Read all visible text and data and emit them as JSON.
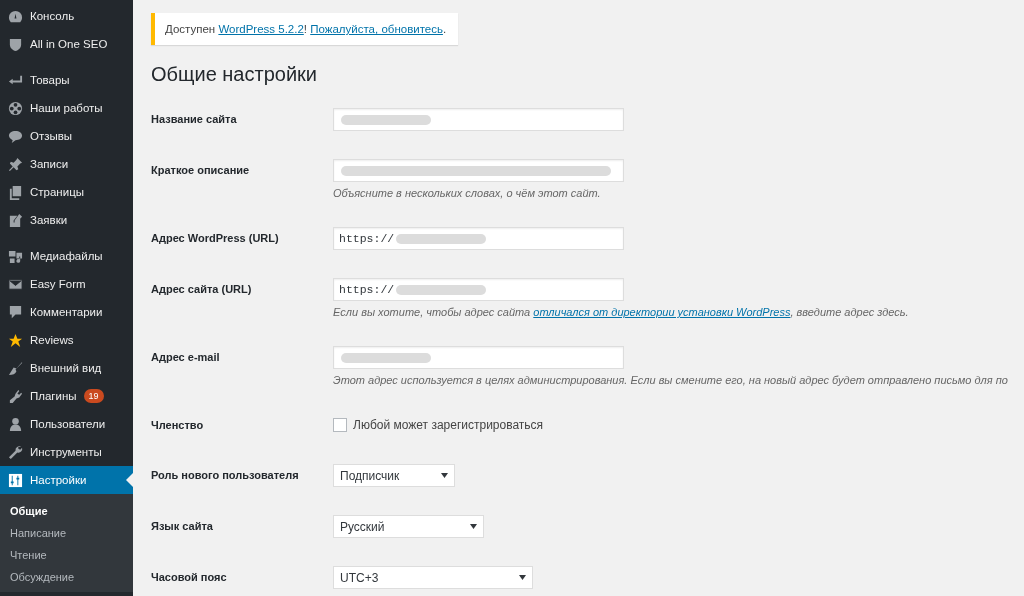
{
  "sidebar": {
    "groups": [
      [
        {
          "label": "Консоль",
          "selected": false
        },
        {
          "label": "All in One SEO",
          "selected": false
        }
      ],
      [
        {
          "label": "Товары",
          "selected": false
        },
        {
          "label": "Наши работы",
          "selected": false
        },
        {
          "label": "Отзывы",
          "selected": false
        },
        {
          "label": "Записи",
          "selected": false
        },
        {
          "label": "Страницы",
          "selected": false
        },
        {
          "label": "Заявки",
          "selected": false
        }
      ],
      [
        {
          "label": "Медиафайлы",
          "selected": false
        },
        {
          "label": "Easy Form",
          "selected": false
        },
        {
          "label": "Комментарии",
          "selected": false
        },
        {
          "label": "Reviews",
          "selected": false
        },
        {
          "label": "Внешний вид",
          "selected": false
        },
        {
          "label": "Плагины",
          "selected": false,
          "badge": "19"
        },
        {
          "label": "Пользователи",
          "selected": false
        },
        {
          "label": "Инструменты",
          "selected": false
        },
        {
          "label": "Настройки",
          "selected": true,
          "submenu": [
            {
              "label": "Общие",
              "selected": true
            },
            {
              "label": "Написание",
              "selected": false
            },
            {
              "label": "Чтение",
              "selected": false
            },
            {
              "label": "Обсуждение",
              "selected": false
            }
          ]
        }
      ]
    ]
  },
  "notice": [
    {
      "text": "Доступен ",
      "link": false
    },
    {
      "text": "WordPress 5.2.2",
      "link": true
    },
    {
      "text": "! ",
      "link": false
    },
    {
      "text": "Пожалуйста, обновитесь",
      "link": true
    },
    {
      "text": ".",
      "link": false
    }
  ],
  "title": "Общие настройки",
  "form": [
    {
      "label": "Название сайта",
      "kind": "text",
      "redacted": true
    },
    {
      "label": "Краткое описание",
      "kind": "text",
      "redacted": true,
      "description": [
        {
          "text": "Объясните в нескольких словах, о чём этот сайт.",
          "link": false
        }
      ]
    },
    {
      "label": "Адрес WordPress (URL)",
      "kind": "url",
      "value": "https://",
      "redacted": true
    },
    {
      "label": "Адрес сайта (URL)",
      "kind": "url",
      "value": "https://",
      "redacted": true,
      "description": [
        {
          "text": "Если вы хотите, чтобы адрес сайта ",
          "link": false
        },
        {
          "text": "отличался от директории установки WordPress",
          "link": true
        },
        {
          "text": ", введите адрес здесь.",
          "link": false
        }
      ]
    },
    {
      "label": "Адрес e-mail",
      "kind": "text",
      "redacted": true,
      "description": [
        {
          "text": "Этот адрес используется в целях администрирования. Если вы смените его, на новый адрес будет отправлено письмо для по",
          "link": false
        }
      ]
    },
    {
      "label": "Членство",
      "kind": "checkbox",
      "checked": false,
      "option": "Любой может зарегистрироваться"
    },
    {
      "label": "Роль нового пользователя",
      "kind": "select",
      "value": "Подписчик"
    },
    {
      "label": "Язык сайта",
      "kind": "select",
      "value": "Русский"
    },
    {
      "label": "Часовой пояс",
      "kind": "select",
      "value": "UTC+3"
    }
  ]
}
